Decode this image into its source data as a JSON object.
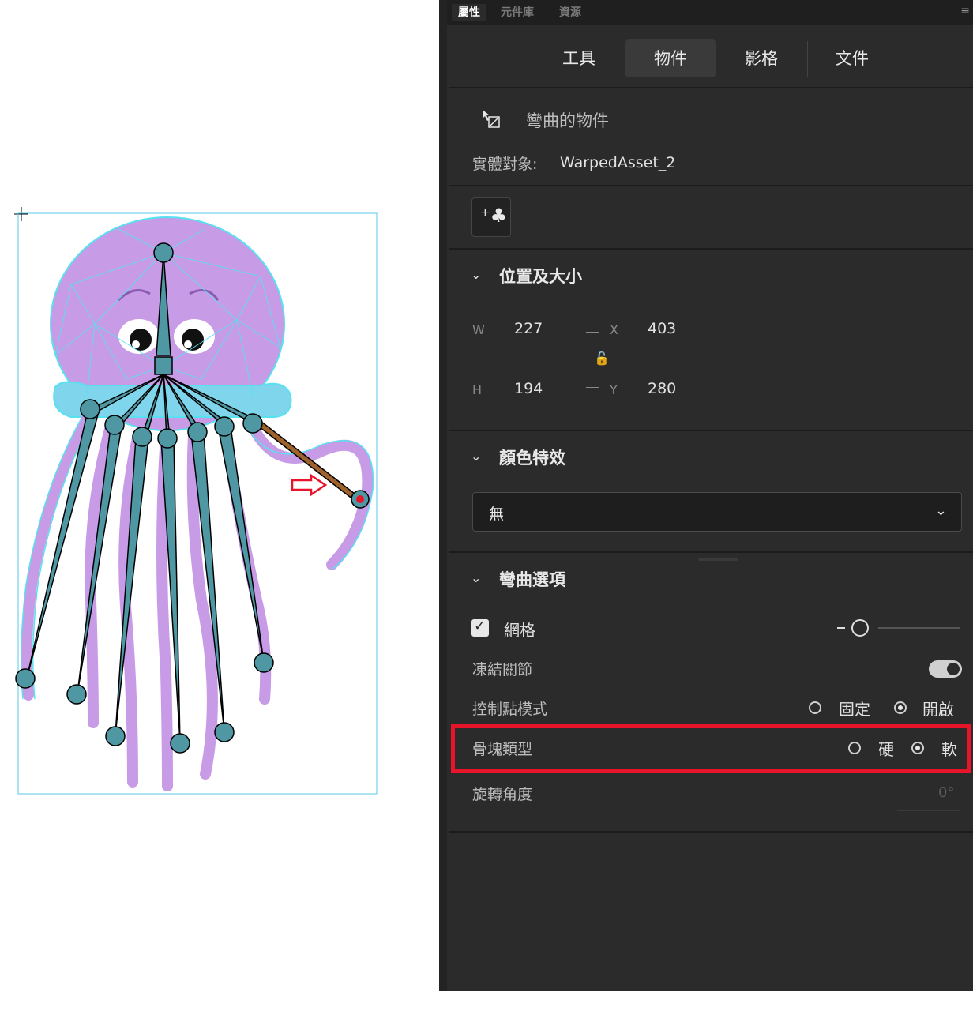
{
  "panel": {
    "tabs": [
      "屬性",
      "元件庫",
      "資源"
    ],
    "top_tabs": [
      "工具",
      "物件",
      "影格",
      "文件"
    ],
    "object_type": "彎曲的物件",
    "instance_label": "實體對象:",
    "instance_value": "WarpedAsset_2"
  },
  "position_size": {
    "title": "位置及大小",
    "w_label": "W",
    "w_value": "227",
    "h_label": "H",
    "h_value": "194",
    "x_label": "X",
    "x_value": "403",
    "y_label": "Y",
    "y_value": "280"
  },
  "color_effect": {
    "title": "顏色特效",
    "selected": "無"
  },
  "warp_options": {
    "title": "彎曲選項",
    "mesh_label": "網格",
    "mesh_checked": true,
    "freeze_label": "凍結關節",
    "freeze_on": true,
    "handle_mode_label": "控制點模式",
    "handle_mode_options": [
      "固定",
      "開啟"
    ],
    "handle_mode_selected": "開啟",
    "bone_type_label": "骨塊類型",
    "bone_type_options": [
      "硬",
      "軟"
    ],
    "bone_type_selected": "軟",
    "rotation_label": "旋轉角度",
    "rotation_value": "0°"
  },
  "colors": {
    "panel_bg": "#2b2b2b",
    "mesh": "#58e1f0",
    "body": "#c79be6",
    "bone": "#4f98a3",
    "highlight": "#e8152a",
    "active_bone": "#a0622c"
  }
}
